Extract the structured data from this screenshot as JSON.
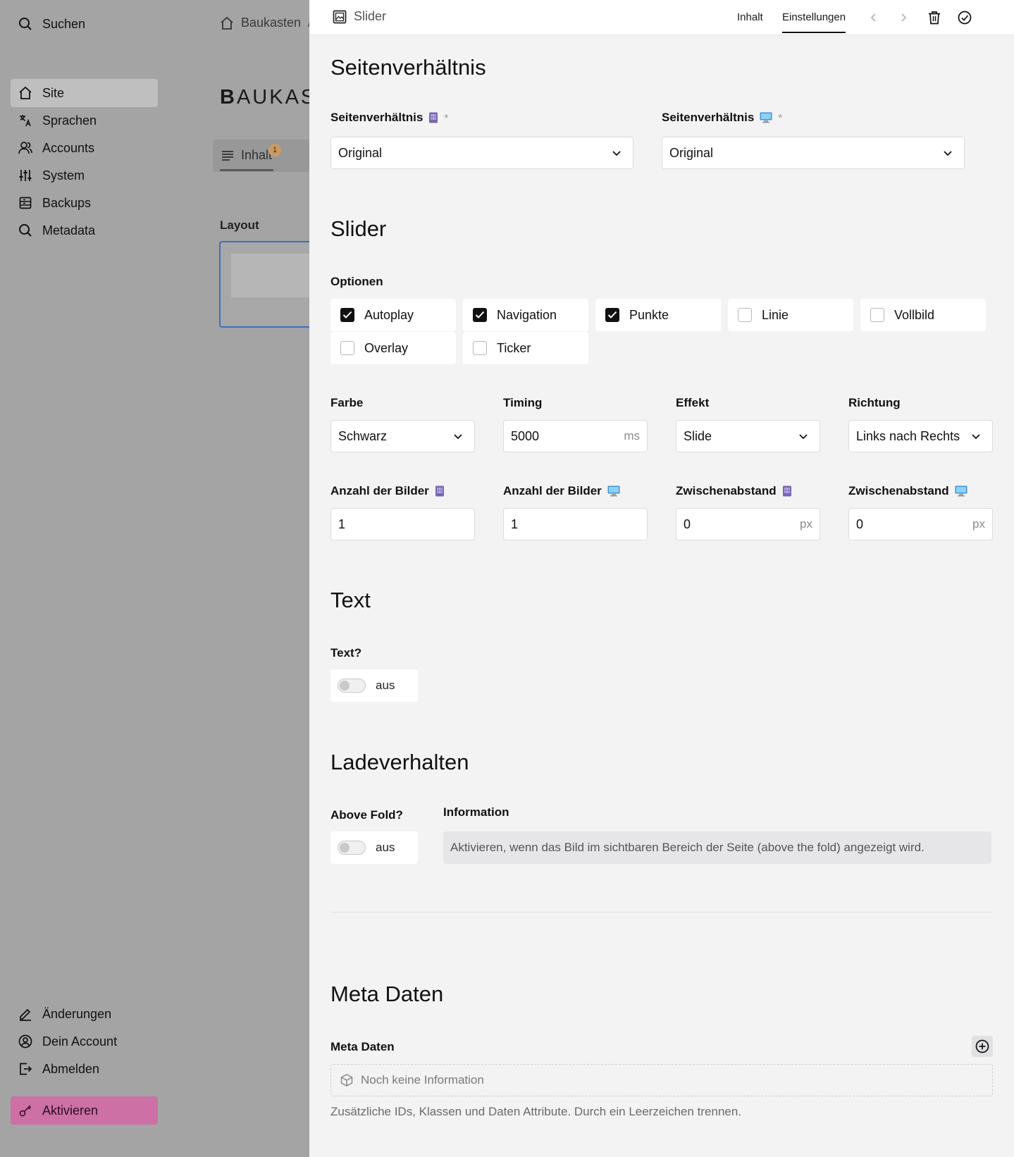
{
  "sidebar": {
    "search_label": "Suchen",
    "nav": [
      {
        "label": "Site",
        "icon": "home-icon",
        "active": true
      },
      {
        "label": "Sprachen",
        "icon": "translate-icon"
      },
      {
        "label": "Accounts",
        "icon": "users-icon"
      },
      {
        "label": "System",
        "icon": "sliders-icon"
      },
      {
        "label": "Backups",
        "icon": "archive-icon"
      },
      {
        "label": "Metadata",
        "icon": "search-icon"
      }
    ],
    "bottom": [
      {
        "label": "Änderungen",
        "icon": "pencil-icon"
      },
      {
        "label": "Dein Account",
        "icon": "user-circle-icon"
      },
      {
        "label": "Abmelden",
        "icon": "logout-icon"
      }
    ],
    "activate_label": "Aktivieren"
  },
  "background": {
    "breadcrumb": "Baukasten",
    "breadcrumb_sep": "/",
    "logo_text": "AUKAS",
    "logo_initial": "B",
    "tab_label": "Inhalt",
    "tab_badge": "1",
    "layout_label": "Layout"
  },
  "drawer": {
    "title": "Slider",
    "tabs": [
      "Inhalt",
      "Einstellungen"
    ],
    "active_tab": "Einstellungen"
  },
  "aspect": {
    "section_title": "Seitenverhältnis",
    "mobile_label": "Seitenverhältnis",
    "desktop_label": "Seitenverhältnis",
    "required_mark": "*",
    "mobile_value": "Original",
    "desktop_value": "Original"
  },
  "slider": {
    "section_title": "Slider",
    "options_label": "Optionen",
    "options": [
      {
        "label": "Autoplay",
        "checked": true
      },
      {
        "label": "Navigation",
        "checked": true
      },
      {
        "label": "Punkte",
        "checked": true
      },
      {
        "label": "Linie",
        "checked": false
      },
      {
        "label": "Vollbild",
        "checked": false
      },
      {
        "label": "Overlay",
        "checked": false
      },
      {
        "label": "Ticker",
        "checked": false
      }
    ],
    "farbe_label": "Farbe",
    "farbe_value": "Schwarz",
    "timing_label": "Timing",
    "timing_value": "5000",
    "timing_unit": "ms",
    "effekt_label": "Effekt",
    "effekt_value": "Slide",
    "richtung_label": "Richtung",
    "richtung_value": "Links nach Rechts",
    "count_mobile_label": "Anzahl der Bilder",
    "count_mobile_value": "1",
    "count_desktop_label": "Anzahl der Bilder",
    "count_desktop_value": "1",
    "gap_mobile_label": "Zwischenabstand",
    "gap_mobile_value": "0",
    "gap_desktop_label": "Zwischenabstand",
    "gap_desktop_value": "0",
    "px_unit": "px"
  },
  "text": {
    "section_title": "Text",
    "toggle_label": "Text?",
    "toggle_state": "aus"
  },
  "loading": {
    "section_title": "Ladeverhalten",
    "fold_label": "Above Fold?",
    "fold_state": "aus",
    "info_label": "Information",
    "info_text": "Aktivieren, wenn das Bild im sichtbaren Bereich der Seite (above the fold) angezeigt wird."
  },
  "meta": {
    "section_title": "Meta Daten",
    "field_label": "Meta Daten",
    "empty_text": "Noch keine Information",
    "help_text": "Zusätzliche IDs, Klassen und Daten Attribute. Durch ein Leerzeichen trennen."
  },
  "colors": {
    "activate_bg": "#cc70a6",
    "overlay": "#a4a4a4",
    "drawer_bg": "#f3f3f4",
    "checkbox_on": "#111111",
    "focus_border": "#3f6fbd"
  }
}
